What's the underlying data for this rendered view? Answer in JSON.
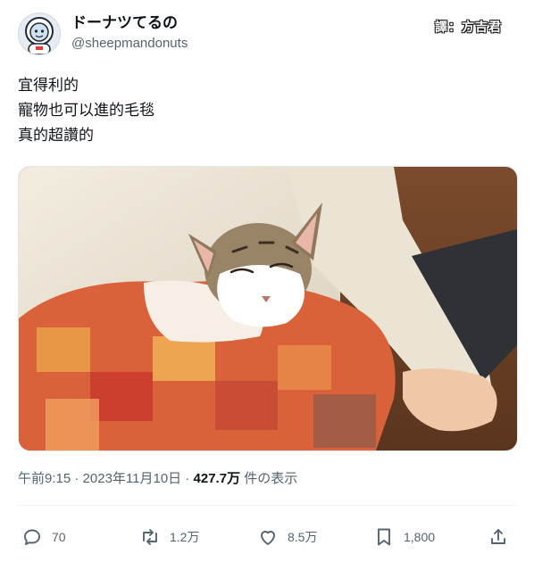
{
  "user": {
    "display_name": "ドーナツてるの",
    "handle": "@sheepmandonuts",
    "avatar_icon": "astronaut-avatar-icon"
  },
  "translator_credit": "譯：方吉君",
  "tweet": {
    "lines": [
      "宜得利的",
      "寵物也可以進的毛毯",
      "真的超讚的"
    ],
    "image_subject": "cat-wrapped-in-blanket-photo"
  },
  "meta": {
    "time": "午前9:15",
    "separator1": " · ",
    "date": "2023年11月10日",
    "separator2": " · ",
    "views_count": "427.7万",
    "views_label": " 件の表示"
  },
  "actions": {
    "reply_count": "70",
    "retweet_count": "1.2万",
    "like_count": "8.5万",
    "bookmark_count": "1,800"
  },
  "colors": {
    "text_primary": "#0f1419",
    "text_secondary": "#536471",
    "divider": "#eff3f4"
  }
}
